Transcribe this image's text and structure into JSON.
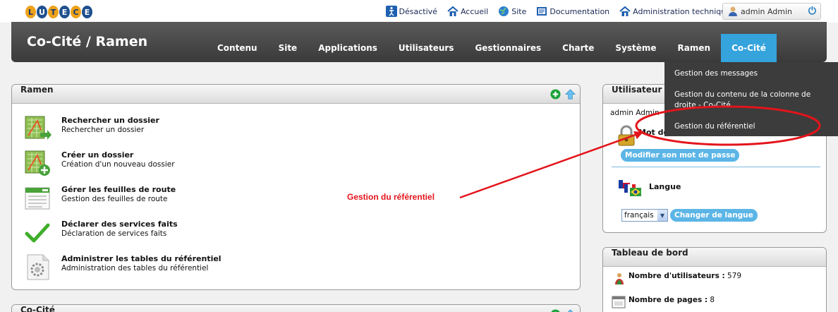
{
  "logo": [
    "L",
    "U",
    "T",
    "E",
    "C",
    "E"
  ],
  "toplinks": [
    {
      "label": "Désactivé",
      "icon": "accessibility-icon"
    },
    {
      "label": "Accueil",
      "icon": "home-icon"
    },
    {
      "label": "Site",
      "icon": "globe-icon"
    },
    {
      "label": "Documentation",
      "icon": "document-icon"
    },
    {
      "label": "Administration technique",
      "icon": "home-icon"
    }
  ],
  "user": {
    "name": "admin Admin"
  },
  "brand": "Co-Cité / Ramen",
  "menu": [
    "Contenu",
    "Site",
    "Applications",
    "Utilisateurs",
    "Gestionnaires",
    "Charte",
    "Système",
    "Ramen",
    "Co-Cité"
  ],
  "dropdown": [
    "Gestion des messages",
    "Gestion du contenu de la colonne de droite - Co-Cité",
    "Gestion du référentiel"
  ],
  "ramen": {
    "title": "Ramen",
    "entries": [
      {
        "title": "Rechercher un dossier",
        "desc": "Rechercher un dossier"
      },
      {
        "title": "Créer un dossier",
        "desc": "Création d'un nouveau dossier"
      },
      {
        "title": "Gérer les feuilles de route",
        "desc": "Gestion des feuilles de route"
      },
      {
        "title": "Déclarer des services faits",
        "desc": "Déclaration de services faits"
      },
      {
        "title": "Administrer les tables du référentiel",
        "desc": "Administration des tables du référentiel"
      }
    ]
  },
  "cocite": {
    "title": "Co-Cité"
  },
  "userpanel": {
    "title": "Utilisateur c",
    "name": "admin Admin",
    "password_label": "Mot de",
    "password_button": "Modifier son mot de passe",
    "language_label": "Langue",
    "language_value": "français",
    "language_button": "Changer de langue"
  },
  "dashboard": {
    "title": "Tableau de bord",
    "users_label": "Nombre d'utilisateurs :",
    "users_value": "579",
    "pages_label": "Nombre de pages :",
    "pages_value": "8"
  },
  "annotation": "Gestion du référentiel"
}
